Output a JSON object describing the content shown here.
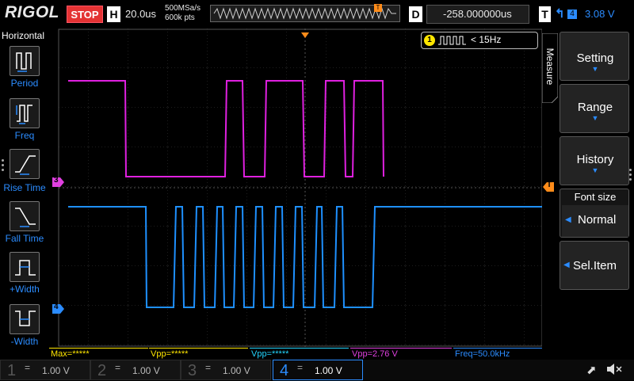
{
  "header": {
    "brand": "RIGOL",
    "run_state": "STOP",
    "horizontal_badge": "H",
    "timebase": "20.0us",
    "sample_rate": "500MSa/s",
    "memory_depth": "600k pts",
    "delay_badge": "D",
    "delay_value": "-258.000000us",
    "trigger_badge": "T",
    "trigger_source": "4",
    "trigger_level": "3.08 V"
  },
  "left_panel": {
    "title": "Horizontal",
    "items": [
      {
        "label": "Period"
      },
      {
        "label": "Freq"
      },
      {
        "label": "Rise Time"
      },
      {
        "label": "Fall Time"
      },
      {
        "label": "+Width"
      },
      {
        "label": "-Width"
      }
    ]
  },
  "screen": {
    "counter_channel": "1",
    "counter_value": "< 15Hz",
    "ch3_marker": "3",
    "ch4_marker": "4",
    "trigger_marker": "T",
    "ch3_level_fraction": 0.2,
    "ch3_high_fraction": 0.62
  },
  "right_panel": {
    "tab_label": "Measure",
    "buttons": [
      {
        "label": "Setting"
      },
      {
        "label": "Range"
      },
      {
        "label": "History"
      }
    ],
    "font_size_title": "Font size",
    "font_size_value": "Normal",
    "sel_item_label": "Sel.Item"
  },
  "measurements": [
    {
      "text": "Max=*****",
      "color": "#ffe600"
    },
    {
      "text": "Vpp=*****",
      "color": "#ffe600"
    },
    {
      "text": "Vpp=*****",
      "color": "#23d6ff"
    },
    {
      "text": "Vpp=2.76 V",
      "color": "#e040e0"
    },
    {
      "text": "Freq=50.0kHz",
      "color": "#2b8cff"
    }
  ],
  "channels": [
    {
      "num": "1",
      "scale": "1.00 V",
      "color": "#ffe600",
      "active": false
    },
    {
      "num": "2",
      "scale": "1.00 V",
      "color": "#23d6ff",
      "active": false
    },
    {
      "num": "3",
      "scale": "1.00 V",
      "color": "#e040e0",
      "active": false
    },
    {
      "num": "4",
      "scale": "1.00 V",
      "color": "#2b8cff",
      "active": true
    }
  ],
  "colors": {
    "ch3_trace": "#e020e0",
    "ch4_trace": "#1e90ff",
    "accent": "#2b8cff",
    "stop": "#e43333"
  },
  "icons": [
    "usb-icon",
    "speaker-mute-icon",
    "trigger-rising-edge-icon"
  ]
}
